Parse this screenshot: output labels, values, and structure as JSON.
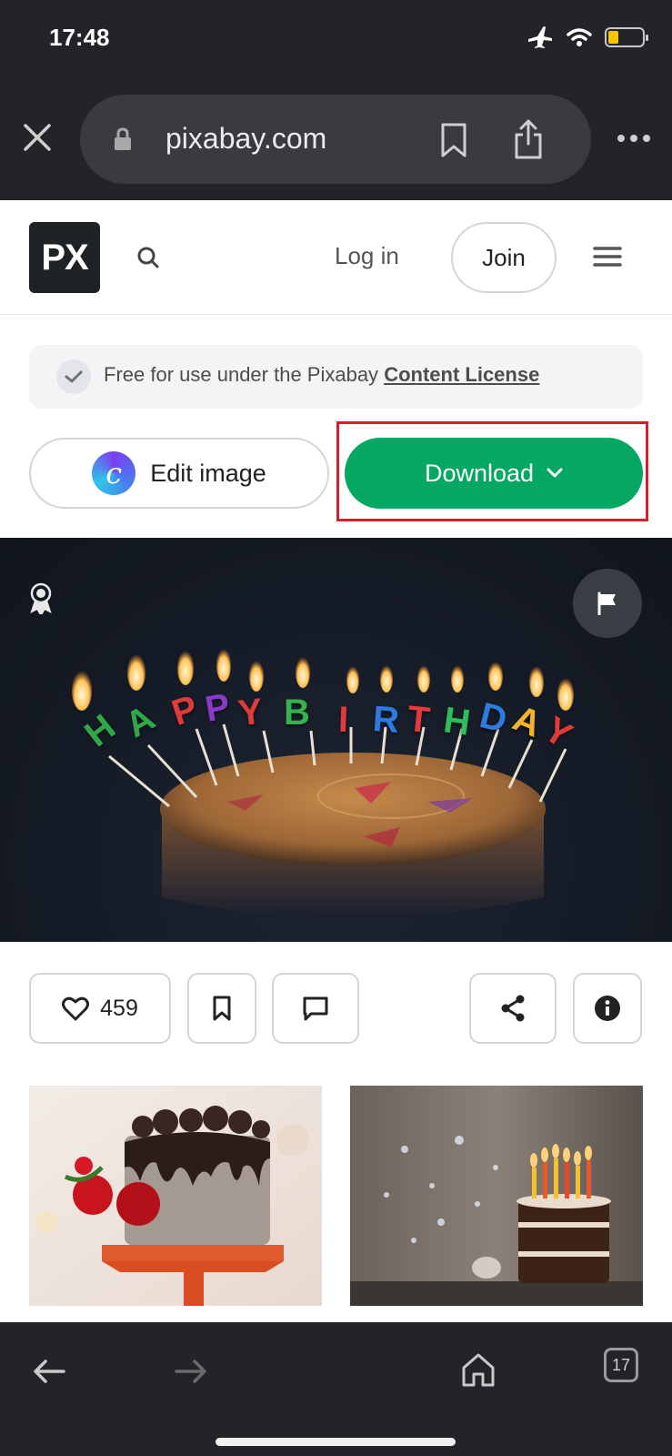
{
  "status_bar": {
    "time": "17:48",
    "battery_level": 0.3,
    "icons": [
      "airplane-icon",
      "wifi-icon",
      "battery-icon"
    ]
  },
  "browser": {
    "url": "pixabay.com",
    "tab_count": "17",
    "icons": [
      "close-icon",
      "lock-icon",
      "bookmark-icon",
      "share-icon",
      "more-icon",
      "back-icon",
      "forward-icon",
      "home-icon"
    ]
  },
  "header": {
    "logo": "PX",
    "login_label": "Log in",
    "join_label": "Join"
  },
  "license": {
    "text": "Free for use under the Pixabay",
    "link": "Content License"
  },
  "actions": {
    "edit_label": "Edit image",
    "download_label": "Download"
  },
  "hero": {
    "candle_letters": [
      "H",
      "A",
      "P",
      "P",
      "Y",
      "B",
      "I",
      "R",
      "T",
      "H",
      "D",
      "A",
      "Y"
    ]
  },
  "reactions": {
    "likes": "459"
  },
  "colors": {
    "brand_green": "#05a862",
    "highlight_red": "#d3202a",
    "chrome_bg": "#232428"
  }
}
